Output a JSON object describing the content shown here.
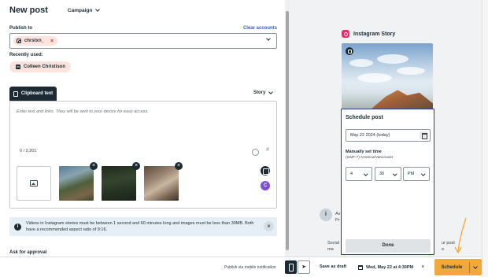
{
  "header": {
    "title": "New post",
    "campaign_label": "Campaign"
  },
  "publish": {
    "label": "Publish to",
    "clear_label": "Clear accounts",
    "selected_account": "chrstxn_",
    "remove_symbol": "×"
  },
  "recent": {
    "label": "Recently used:",
    "chip_label": "Colleen Christison",
    "chip_network_glyph": "in"
  },
  "composer": {
    "tab_label": "Clipboard text",
    "type_label": "Story",
    "placeholder": "Enter text and links. They will be sent to your device for easy access.",
    "char_count": "0 / 2,201",
    "hashtag_symbol": "#",
    "remove_symbol": "×",
    "ai_button_letter": "C"
  },
  "info_banner": {
    "icon_glyph": "i",
    "text": "Videos in Instagram stories must be between 1 second and 60 minutes long and images must be less than 30MB. Both have a recommended aspect ratio of 9:16.",
    "close_symbol": "×"
  },
  "approval": {
    "label": "Ask for approval"
  },
  "preview": {
    "network_title": "Instagram Story",
    "info_line1": "Av",
    "info_line2": "Pr",
    "social_line1": "Social",
    "social_line2": "ma",
    "yourpost_line1": "ur post",
    "yourpost_line2": "e."
  },
  "schedule_popup": {
    "title": "Schedule post",
    "date_value": "May 22 2024 (today)",
    "time_label": "Manually set time",
    "timezone": "(GMT-7) America/Vancouver",
    "hour": "4",
    "minute": "30",
    "ampm": "PM",
    "done_label": "Done"
  },
  "bottom_bar": {
    "mobile_notification_label": "Publish via mobile notification",
    "send_glyph": "➤",
    "save_draft_label": "Save as draft",
    "scheduled_date": "Wed, May 22 at 4:30PM",
    "clear_symbol": "×",
    "schedule_label": "Schedule"
  },
  "colors": {
    "accent_orange": "#f2a93b",
    "dark": "#1c2b33",
    "link_blue": "#3b5cc4",
    "chip_pink": "#fde3de",
    "popup_border": "#2b3a8f",
    "info_bg": "#e6eff6"
  }
}
